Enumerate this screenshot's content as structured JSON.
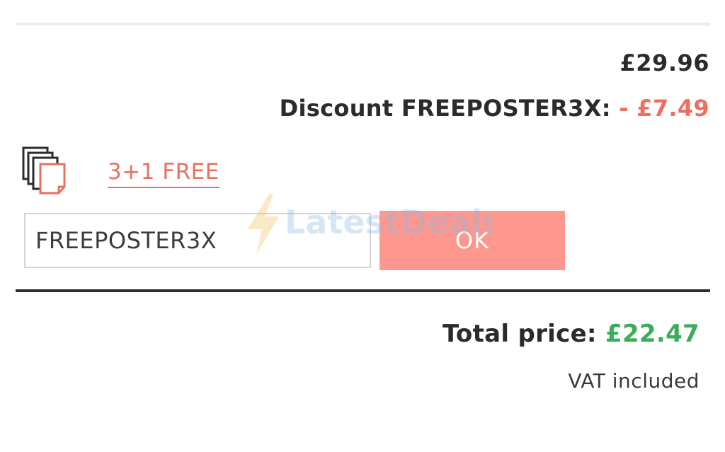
{
  "cart": {
    "subtotal": "£29.96",
    "discount_label": "Discount FREEPOSTER3X:",
    "discount_amount": "- £7.49"
  },
  "promo": {
    "icon": "poster-stack-icon",
    "link_text": "3+1 FREE"
  },
  "coupon": {
    "value": "FREEPOSTER3X",
    "ok_label": "OK"
  },
  "watermark": {
    "text": "LatestDeals"
  },
  "total": {
    "label": "Total price:",
    "amount": "£22.47",
    "vat_note": "VAT included"
  },
  "colors": {
    "discount": "#ec6f5f",
    "link": "#e9705f",
    "ok_button": "#fe978d",
    "total": "#3aac5a",
    "divider": "#2d2d33"
  }
}
